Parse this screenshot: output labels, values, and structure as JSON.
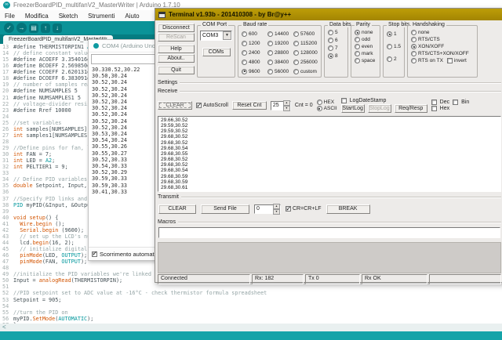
{
  "arduino": {
    "window_title": "FreezerBoardPID_multifanV2_MasterWriter | Arduino 1.7.10",
    "menu": [
      "File",
      "Modifica",
      "Sketch",
      "Strumenti",
      "Aiuto"
    ],
    "toolbar": [
      {
        "name": "verify",
        "glyph": "✓",
        "shape": "round"
      },
      {
        "name": "upload",
        "glyph": "→",
        "shape": "round"
      },
      {
        "name": "new-sketch",
        "glyph": "▤",
        "shape": "square"
      },
      {
        "name": "open",
        "glyph": "↑",
        "shape": "square"
      },
      {
        "name": "save",
        "glyph": "↓",
        "shape": "square"
      }
    ],
    "tab_title": "FreezerBoardPID_multifanV2_MasterWr",
    "hscroll_arrow": "<",
    "syntax_colors": {
      "k": "#D35400",
      "f": "#D35400",
      "c": "#00979C",
      "m": "#95A5A6",
      "p": "#434F54"
    },
    "code": [
      {
        "n": 13,
        "s": [
          [
            "p",
            "#define THERMISTORPIN1 "
          ],
          [
            "c",
            "A1"
          ]
        ]
      },
      {
        "n": 14,
        "s": [
          [
            "m",
            "// define constant values of s"
          ]
        ]
      },
      {
        "n": 15,
        "s": [
          [
            "p",
            "#define ACOEFF 3.354016e-3"
          ]
        ]
      },
      {
        "n": 16,
        "s": [
          [
            "p",
            "#define BCOEFF 2.569850e-4"
          ]
        ]
      },
      {
        "n": 17,
        "s": [
          [
            "p",
            "#define CCOEFF 2.620131e-6"
          ]
        ]
      },
      {
        "n": 18,
        "s": [
          [
            "p",
            "#define DCOEFF 6.383091e-8"
          ]
        ]
      },
      {
        "n": 19,
        "s": [
          [
            "m",
            "// number of samples readings"
          ]
        ]
      },
      {
        "n": 20,
        "s": [
          [
            "p",
            "#define NUMSAMPLES 5"
          ]
        ]
      },
      {
        "n": 21,
        "s": [
          [
            "p",
            "#define NUMSAMPLES1 5"
          ]
        ]
      },
      {
        "n": 22,
        "s": [
          [
            "m",
            "// voltage-divider resistance"
          ]
        ]
      },
      {
        "n": 23,
        "s": [
          [
            "p",
            "#define Rref 10000"
          ]
        ]
      },
      {
        "n": 24,
        "s": []
      },
      {
        "n": 25,
        "s": [
          [
            "m",
            "//set variables"
          ]
        ]
      },
      {
        "n": 26,
        "s": [
          [
            "k",
            "int"
          ],
          [
            "p",
            " samples[NUMSAMPLES];"
          ]
        ]
      },
      {
        "n": 27,
        "s": [
          [
            "k",
            "int"
          ],
          [
            "p",
            " samples1[NUMSAMPLES1];"
          ]
        ]
      },
      {
        "n": 28,
        "s": []
      },
      {
        "n": 29,
        "s": [
          [
            "m",
            "//Define pins for fan, led an"
          ]
        ]
      },
      {
        "n": 30,
        "s": [
          [
            "k",
            "int"
          ],
          [
            "p",
            " FAN = 7;"
          ]
        ]
      },
      {
        "n": 31,
        "s": [
          [
            "k",
            "int"
          ],
          [
            "p",
            " LED = "
          ],
          [
            "c",
            "A2"
          ],
          [
            "p",
            ";"
          ]
        ]
      },
      {
        "n": 32,
        "s": [
          [
            "k",
            "int"
          ],
          [
            "p",
            " PELTIER1 = 9;"
          ]
        ]
      },
      {
        "n": 33,
        "s": []
      },
      {
        "n": 34,
        "s": [
          [
            "m",
            "// Define PID variables"
          ]
        ]
      },
      {
        "n": 35,
        "s": [
          [
            "k",
            "double"
          ],
          [
            "p",
            " Setpoint, Input, Outp"
          ]
        ]
      },
      {
        "n": 36,
        "s": []
      },
      {
        "n": 37,
        "s": [
          [
            "m",
            "//Specify PID links and init"
          ]
        ]
      },
      {
        "n": 38,
        "s": [
          [
            "c",
            "PID"
          ],
          [
            "p",
            " myPID(&Input, &Output, &"
          ]
        ]
      },
      {
        "n": 39,
        "s": []
      },
      {
        "n": 40,
        "s": [
          [
            "k",
            "void"
          ],
          [
            "p",
            " "
          ],
          [
            "f",
            "setup"
          ],
          [
            "p",
            "() {"
          ]
        ]
      },
      {
        "n": 41,
        "s": [
          [
            "p",
            "  "
          ],
          [
            "f",
            "Wire"
          ],
          [
            "p",
            "."
          ],
          [
            "f",
            "begin"
          ],
          [
            "p",
            " ();"
          ]
        ]
      },
      {
        "n": 42,
        "s": [
          [
            "p",
            "  "
          ],
          [
            "f",
            "Serial"
          ],
          [
            "p",
            "."
          ],
          [
            "f",
            "begin"
          ],
          [
            "p",
            " (9600);"
          ]
        ]
      },
      {
        "n": 43,
        "s": [
          [
            "m",
            "  // set up the LCD's number"
          ]
        ]
      },
      {
        "n": 44,
        "s": [
          [
            "p",
            "  lcd."
          ],
          [
            "f",
            "begin"
          ],
          [
            "p",
            "(16, 2);"
          ]
        ]
      },
      {
        "n": 45,
        "s": [
          [
            "m",
            "  // initialize digital pins"
          ]
        ]
      },
      {
        "n": 46,
        "s": [
          [
            "p",
            "  "
          ],
          [
            "f",
            "pinMode"
          ],
          [
            "p",
            "(LED, "
          ],
          [
            "c",
            "OUTPUT"
          ],
          [
            "p",
            ");"
          ]
        ]
      },
      {
        "n": 47,
        "s": [
          [
            "p",
            "  "
          ],
          [
            "f",
            "pinMode"
          ],
          [
            "p",
            "(FAN, "
          ],
          [
            "c",
            "OUTPUT"
          ],
          [
            "p",
            ");"
          ]
        ]
      },
      {
        "n": 48,
        "s": []
      },
      {
        "n": 49,
        "s": [
          [
            "m",
            "//initialize the PID variables we're linked to"
          ]
        ]
      },
      {
        "n": 50,
        "s": [
          [
            "p",
            "Input = "
          ],
          [
            "f",
            "analogRead"
          ],
          [
            "p",
            "(THERMISTORPIN);"
          ]
        ]
      },
      {
        "n": 51,
        "s": []
      },
      {
        "n": 52,
        "s": [
          [
            "m",
            "//PID setpoint set to ADC value at -16°C - check thermistor formula spreadsheet"
          ]
        ]
      },
      {
        "n": 53,
        "s": [
          [
            "p",
            "Setpoint = 905;"
          ]
        ]
      },
      {
        "n": 54,
        "s": []
      },
      {
        "n": 55,
        "s": [
          [
            "m",
            "//turn the PID on"
          ]
        ]
      },
      {
        "n": 56,
        "s": [
          [
            "p",
            "myPID."
          ],
          [
            "f",
            "SetMode"
          ],
          [
            "p",
            "("
          ],
          [
            "c",
            "AUTOMATIC"
          ],
          [
            "p",
            ");"
          ]
        ]
      },
      {
        "n": 57,
        "s": [
          [
            "p",
            "}"
          ]
        ]
      }
    ]
  },
  "serial_monitor": {
    "title": "COM4 (Arduino Uno",
    "send_value": "",
    "lines": [
      "30.330.52,30.22",
      "30.50,30.24",
      "30.52,30.24",
      "30.52,30.24",
      "30.52,30.24",
      "30.52,30.24",
      "30.52,30.24",
      "30.52,30.24",
      "30.52,30.24",
      "30.52,30.24",
      "30.53,30.24",
      "30.54,30.24",
      "30.55,30.26",
      "30.55,30.27",
      "30.52,30.33",
      "30.54,30.33",
      "30.52,30.29",
      "30.59,30.33",
      "30.59,30.33",
      "30.41,30.33"
    ],
    "autoscroll": {
      "label": "Scorrimento automatico",
      "checked": true
    }
  },
  "terminal": {
    "title": "Terminal v1.93b - 201410308 - by Br@y++",
    "buttons": [
      {
        "label": "Disconnect",
        "enabled": true
      },
      {
        "label": "ReScan",
        "enabled": false
      },
      {
        "label": "Help",
        "enabled": true
      },
      {
        "label": "About..",
        "enabled": true
      },
      {
        "label": "Quit",
        "enabled": true
      }
    ],
    "com_port": {
      "label": "COM Port",
      "selected": "COM3",
      "coms_button": "COMs"
    },
    "baud": {
      "label": "Baud rate",
      "selected": "9600",
      "options": [
        "600",
        "1200",
        "2400",
        "4800",
        "9600",
        "14400",
        "19200",
        "28800",
        "38400",
        "56000",
        "57600",
        "115200",
        "128000",
        "256000",
        "custom"
      ]
    },
    "data_bits": {
      "label": "Data bits",
      "selected": "8",
      "options": [
        "5",
        "6",
        "7",
        "8"
      ]
    },
    "parity": {
      "label": "Parity",
      "selected": "none",
      "options": [
        "none",
        "odd",
        "even",
        "mark",
        "space"
      ]
    },
    "stop_bits": {
      "label": "Stop bits",
      "selected": "1",
      "options": [
        "1",
        "1.5",
        "2"
      ]
    },
    "handshaking": {
      "label": "Handshaking",
      "selected": "XON/XOFF",
      "options": [
        "none",
        "RTS/CTS",
        "XON/XOFF",
        "RTS/CTS+XON/XOFF",
        "RTS on TX"
      ],
      "invert": {
        "label": "invert",
        "checked": false
      }
    },
    "settings_label": "Settings",
    "receive": {
      "label": "Receive",
      "clear_button": "CLEAR",
      "autoscroll": {
        "label": "AutoScroll",
        "checked": true
      },
      "reset_cnt_button": "Reset Cnt",
      "counter_value": "25",
      "cnt_text": "Cnt = 0",
      "mode": {
        "selected": "ASCII",
        "options": [
          "HEX",
          "ASCII"
        ]
      },
      "log_datestamp": {
        "label": "LogDateStamp",
        "checked": false
      },
      "startlog_button": "StartLog",
      "stoplog_button": "StopLog",
      "reqresp_button": "Req/Resp",
      "dec": {
        "label": "Dec",
        "checked": false
      },
      "bin": {
        "label": "Bin",
        "checked": false
      },
      "hex": {
        "label": "Hex",
        "checked": false
      },
      "lines": [
        "29.66,30.52",
        "29.59,30.52",
        "29.59,30.52",
        "29.68,30.52",
        "29.68,30.52",
        "29.68,30.54",
        "29.68,30.55",
        "29.68,30.52",
        "29.68,30.52",
        "29.68,30.54",
        "29.68,30.59",
        "29.68,30.59",
        "29.68,30.61"
      ]
    },
    "transmit": {
      "label": "Transmit",
      "clear_button": "CLEAR",
      "sendfile_button": "Send File",
      "spinner_value": "0",
      "crlf": {
        "label": "CR=CR+LF",
        "checked": true
      },
      "break_button": "BREAK"
    },
    "macros": {
      "label": "Macros",
      "input_value": ""
    },
    "status_cells": [
      "Connected",
      "Rx: 182",
      "Tx  0",
      "Rx OK",
      ""
    ]
  }
}
